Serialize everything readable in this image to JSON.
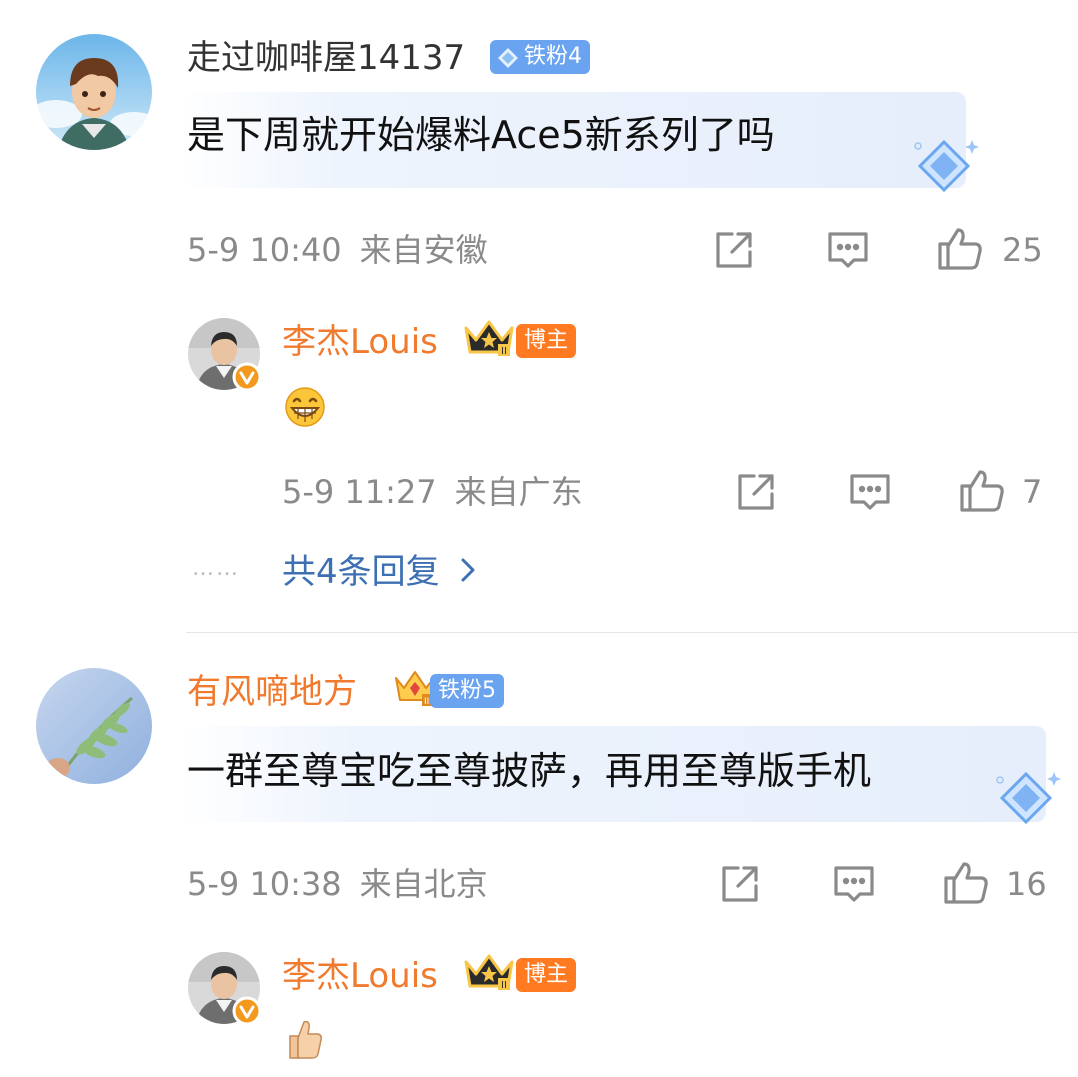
{
  "comments": [
    {
      "username": "走过咖啡屋14137",
      "fan_badge": "铁粉4",
      "text": "是下周就开始爆料Ace5新系列了吗",
      "time": "5-9 10:40",
      "location": "来自安徽",
      "likes": "25",
      "reply": {
        "username": "李杰Louis",
        "host_badge": "博主",
        "emoji": "grinning-face",
        "time": "5-9 11:27",
        "location": "来自广东",
        "likes": "7"
      },
      "more_replies": "共4条回复",
      "more_dots": "……"
    },
    {
      "username": "有风嘀地方",
      "fan_badge": "铁粉5",
      "text": "一群至尊宝吃至尊披萨，再用至尊版手机",
      "time": "5-9 10:38",
      "location": "来自北京",
      "likes": "16",
      "reply": {
        "username": "李杰Louis",
        "host_badge": "博主",
        "emoji": "thumbs-up"
      }
    }
  ],
  "colors": {
    "accent_orange": "#f07a2e",
    "link_blue": "#3d6fb3",
    "fan_badge_blue": "#6aa3ef",
    "host_badge_orange": "#ff7a21",
    "meta_gray": "#8a8a8a"
  },
  "icons": [
    "share-icon",
    "comment-icon",
    "like-icon",
    "verified-icon",
    "crown-icon",
    "diamond-icon",
    "chevron-right-icon"
  ]
}
